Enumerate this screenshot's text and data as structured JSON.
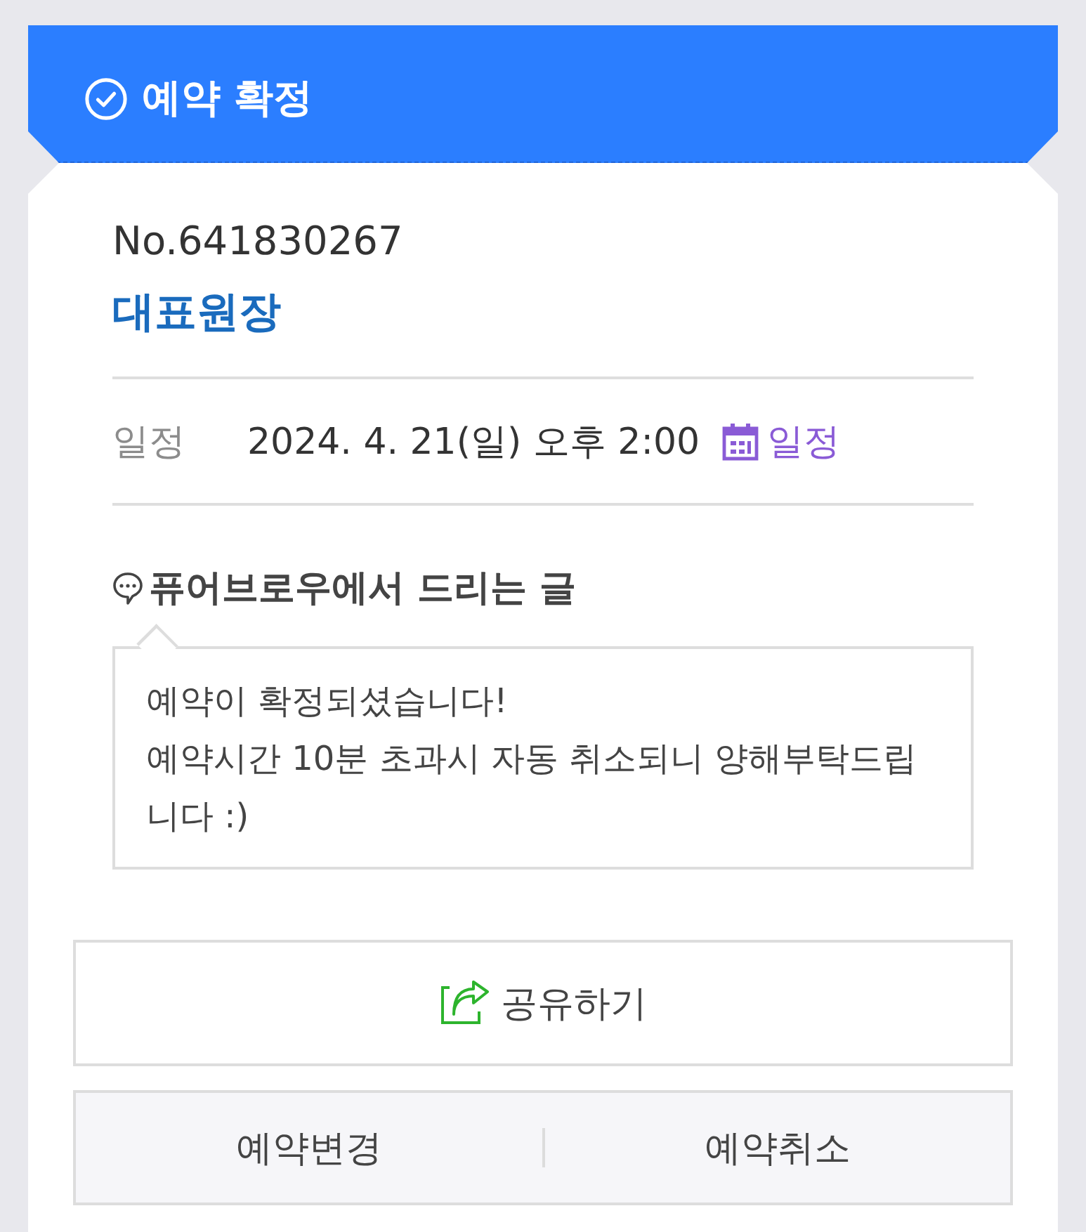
{
  "header": {
    "title": "예약 확정"
  },
  "booking": {
    "number": "No.641830267",
    "name": "대표원장"
  },
  "schedule": {
    "label": "일정",
    "value": "2024. 4. 21(일) 오후 2:00",
    "calendar_link": "일정"
  },
  "message": {
    "title": "퓨어브로우에서 드리는 글",
    "lines": [
      "예약이 확정되셨습니다!",
      "예약시간 10분 초과시 자동 취소되니 양해부탁드립니다 :)"
    ]
  },
  "share_button": {
    "label": "공유하기"
  },
  "actions": [
    {
      "label": "예약변경"
    },
    {
      "label": "예약취소"
    }
  ]
}
